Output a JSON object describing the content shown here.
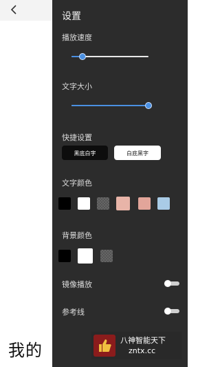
{
  "background": {
    "back_icon": "chevron-left-icon",
    "text": "我的"
  },
  "settings": {
    "title": "设置",
    "playback_speed": {
      "label": "播放速度",
      "value": 0.14
    },
    "text_size": {
      "label": "文字大小",
      "value": 1.0
    },
    "quick_settings": {
      "label": "快捷设置",
      "options": [
        "黑底白字",
        "白底黑字"
      ]
    },
    "text_color": {
      "label": "文字颜色",
      "swatches": [
        "#000000",
        "#ffffff",
        "checker",
        "#e8b4a8",
        "#e2a59a",
        "#a9cbe6"
      ]
    },
    "background_color": {
      "label": "背景颜色",
      "swatches": [
        "#000000",
        "#ffffff",
        "checker"
      ]
    },
    "mirror_play": {
      "label": "镜像播放",
      "on": false
    },
    "reference_line": {
      "label": "参考线",
      "on": false
    }
  },
  "watermark": {
    "line1": "八神智能天下",
    "line2": "zntx.cc"
  }
}
